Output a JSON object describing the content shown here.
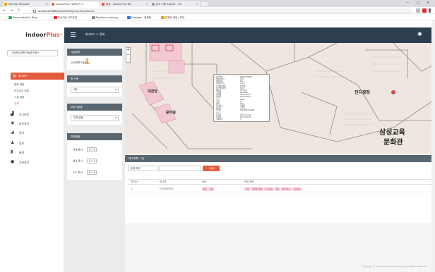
{
  "browser": {
    "tabs": [
      {
        "label": "ABI Text Request",
        "color": "#f0a500"
      },
      {
        "label": "IndoorPlus+ WMS 관 ×",
        "color": "#e25c3c"
      },
      {
        "label": "일정 - Indoor Plus Tail",
        "color": "#e25c3c"
      },
      {
        "label": "분석 이용 degree - Go",
        "color": "#999999"
      }
    ],
    "url": "localhost:8080/site/facility/monitor/list.do",
    "window_controls": [
      "−",
      "□",
      "×"
    ],
    "bookmarks": [
      {
        "label": "Naver Health's Blog",
        "color": "#2ab34d"
      },
      {
        "label": "머신러닝 기초강좌",
        "color": "#e22929"
      },
      {
        "label": "Machine Learning",
        "color": "#888888"
      },
      {
        "label": "Dropbox - 정동형",
        "color": "#2a6fdb"
      },
      {
        "label": "분양로 성일 | 포세",
        "color": "#f0a500"
      }
    ]
  },
  "app": {
    "logo_text": "Indoor",
    "logo_plus": "Plus⁺",
    "breadcrumb": "대시보드  >  관제",
    "site_select": "(대)한국과학기술연구원 ▾",
    "menu_main": "대시보드",
    "submenu": [
      "통합 현황",
      "보유자산 현황",
      "시설 현황",
      "관제"
    ],
    "nav_items": [
      {
        "label": "모니터링",
        "icon": "chart-icon",
        "glyph": "▟"
      },
      {
        "label": "보유자산",
        "icon": "target-icon",
        "glyph": "◉"
      },
      {
        "label": "센서",
        "icon": "signal-icon",
        "glyph": "◢"
      },
      {
        "label": "정보",
        "icon": "person-icon",
        "glyph": "♟"
      },
      {
        "label": "통계",
        "icon": "bar-icon",
        "glyph": "▮"
      },
      {
        "label": "기본정보",
        "icon": "info-icon",
        "glyph": "●"
      }
    ]
  },
  "filters": {
    "facility_header": "시설정보",
    "facility_name": "(대)과학기술원",
    "facility_count": "1",
    "floor_header": "층 선택",
    "floor_value": "1층",
    "sensor_header": "보유자원별",
    "sensor_value": "선택 없음",
    "status_header": "관제현황",
    "status_rows": [
      {
        "label": "관제 표시",
        "toggle": "표시 중"
      },
      {
        "label": "센서 표시",
        "toggle": "표시 중"
      },
      {
        "label": "노드 표시",
        "toggle": "표시 중"
      }
    ]
  },
  "map": {
    "labels": [
      {
        "text": "삼성교육",
        "size": "15px"
      },
      {
        "text": "문화관",
        "size": "15px"
      },
      {
        "text": "잔디광장",
        "size": "7px"
      },
      {
        "text": "준비실",
        "size": "6px"
      },
      {
        "text": "대강당",
        "size": "6px"
      }
    ],
    "zoom_in": "+",
    "zoom_out": "−",
    "info_rows": [
      [
        "자산번호",
        "D201700001"
      ],
      [
        "위치(건물)",
        "본관"
      ],
      [
        "위치(층)",
        "1층"
      ],
      [
        "위치(구역)",
        "A구역"
      ],
      [
        "자산명(계열)",
        "전력계"
      ],
      [
        "자산명(세부)",
        "센서"
      ],
      [
        "제조사",
        "한국전력"
      ],
      [
        "모델명",
        "KP-2000"
      ],
      [
        "설치일",
        "2017-03-01"
      ],
      [
        "점검일",
        "2017-03-15"
      ],
      [
        "규격",
        "220V"
      ],
      [
        "수량",
        "1"
      ],
      [
        "상태",
        "정상"
      ],
      [
        "담당부서",
        "시설팀"
      ],
      [
        "담당자",
        "홍길동"
      ],
      [
        "연락처",
        "010-0000-0000"
      ],
      [
        "비고",
        "-"
      ],
      [
        "등록일",
        "2017-01-01"
      ],
      [
        "수정일",
        "2017-03-20"
      ],
      [
        "관제여부",
        "Y"
      ]
    ]
  },
  "table": {
    "header": "태그목록 : 1건",
    "search_select": "검색 조건",
    "search_button": "검색",
    "columns": [
      "태그ID",
      "태그명",
      "상태",
      "관련 정보"
    ],
    "rows": [
      {
        "id": "1",
        "name": "D10000001",
        "status": [
          "정상",
          "운영"
        ],
        "tags": [
          "전력",
          "전력계(계열)",
          "추가정보",
          "위치",
          "센서(태그)",
          "기타정보"
        ]
      }
    ]
  },
  "footer": "Copyright © 2017 IndoorPlus Technology. All Rights Reserved."
}
